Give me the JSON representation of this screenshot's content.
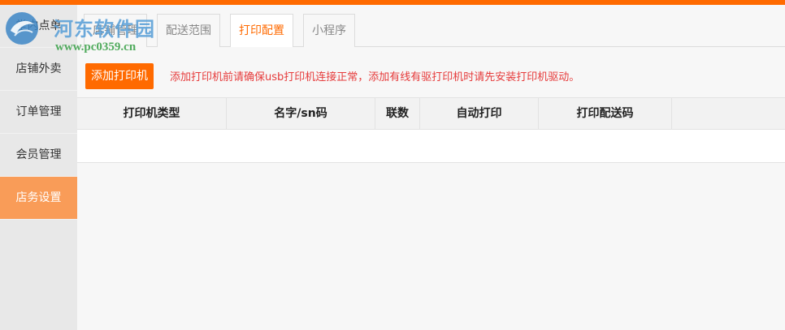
{
  "sidebar": {
    "items": [
      {
        "label": "堂内点单"
      },
      {
        "label": "店铺外卖"
      },
      {
        "label": "订单管理"
      },
      {
        "label": "会员管理"
      },
      {
        "label": "店务设置"
      }
    ],
    "active_index": 4
  },
  "tabs": [
    {
      "label": "店铺管理"
    },
    {
      "label": "配送范围"
    },
    {
      "label": "打印配置"
    },
    {
      "label": "小程序"
    }
  ],
  "active_tab_index": 2,
  "toolbar": {
    "add_label": "添加打印机",
    "tip": "添加打印机前请确保usb打印机连接正常，添加有线有驱打印机时请先安装打印机驱动。"
  },
  "table": {
    "headers": [
      "打印机类型",
      "名字/sn码",
      "联数",
      "自动打印",
      "打印配送码"
    ],
    "rows": []
  },
  "watermark": {
    "title": "河东软件园",
    "url": "www.pc0359.cn"
  },
  "colors": {
    "accent": "#ff6a00",
    "sidebar_active": "#f99c58",
    "tip_text": "#e63b3b"
  }
}
